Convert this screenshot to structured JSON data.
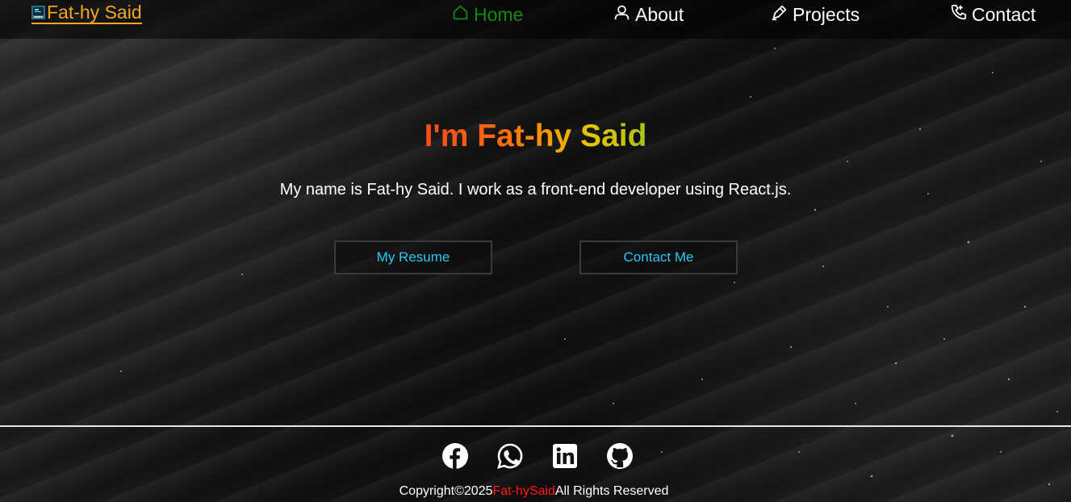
{
  "colors": {
    "brand": "#f5a623",
    "active_nav": "#138a13",
    "button_text": "#2ec7f5",
    "copyright_name": "#ff1a1a"
  },
  "navbar": {
    "brand": {
      "logo_icon": "portfolio-logo-icon",
      "text": "Fat-hy Said"
    },
    "items": [
      {
        "label": "Home",
        "icon": "home-icon",
        "active": true
      },
      {
        "label": "About",
        "icon": "user-icon",
        "active": false
      },
      {
        "label": "Projects",
        "icon": "pen-icon",
        "active": false
      },
      {
        "label": "Contact",
        "icon": "phone-plus-icon",
        "active": false
      }
    ]
  },
  "hero": {
    "title": "I'm Fat-hy Said",
    "description": "My name is Fat-hy Said. I work as a front-end developer using React.js.",
    "buttons": {
      "resume": "My Resume",
      "contact": "Contact Me"
    }
  },
  "footer": {
    "socials": [
      {
        "name": "facebook-icon"
      },
      {
        "name": "whatsapp-icon"
      },
      {
        "name": "linkedin-icon"
      },
      {
        "name": "github-icon"
      }
    ],
    "copyright_prefix": "Copyright©2025",
    "copyright_name": "Fat-hySaid",
    "copyright_suffix": "All Rights Reserved"
  }
}
